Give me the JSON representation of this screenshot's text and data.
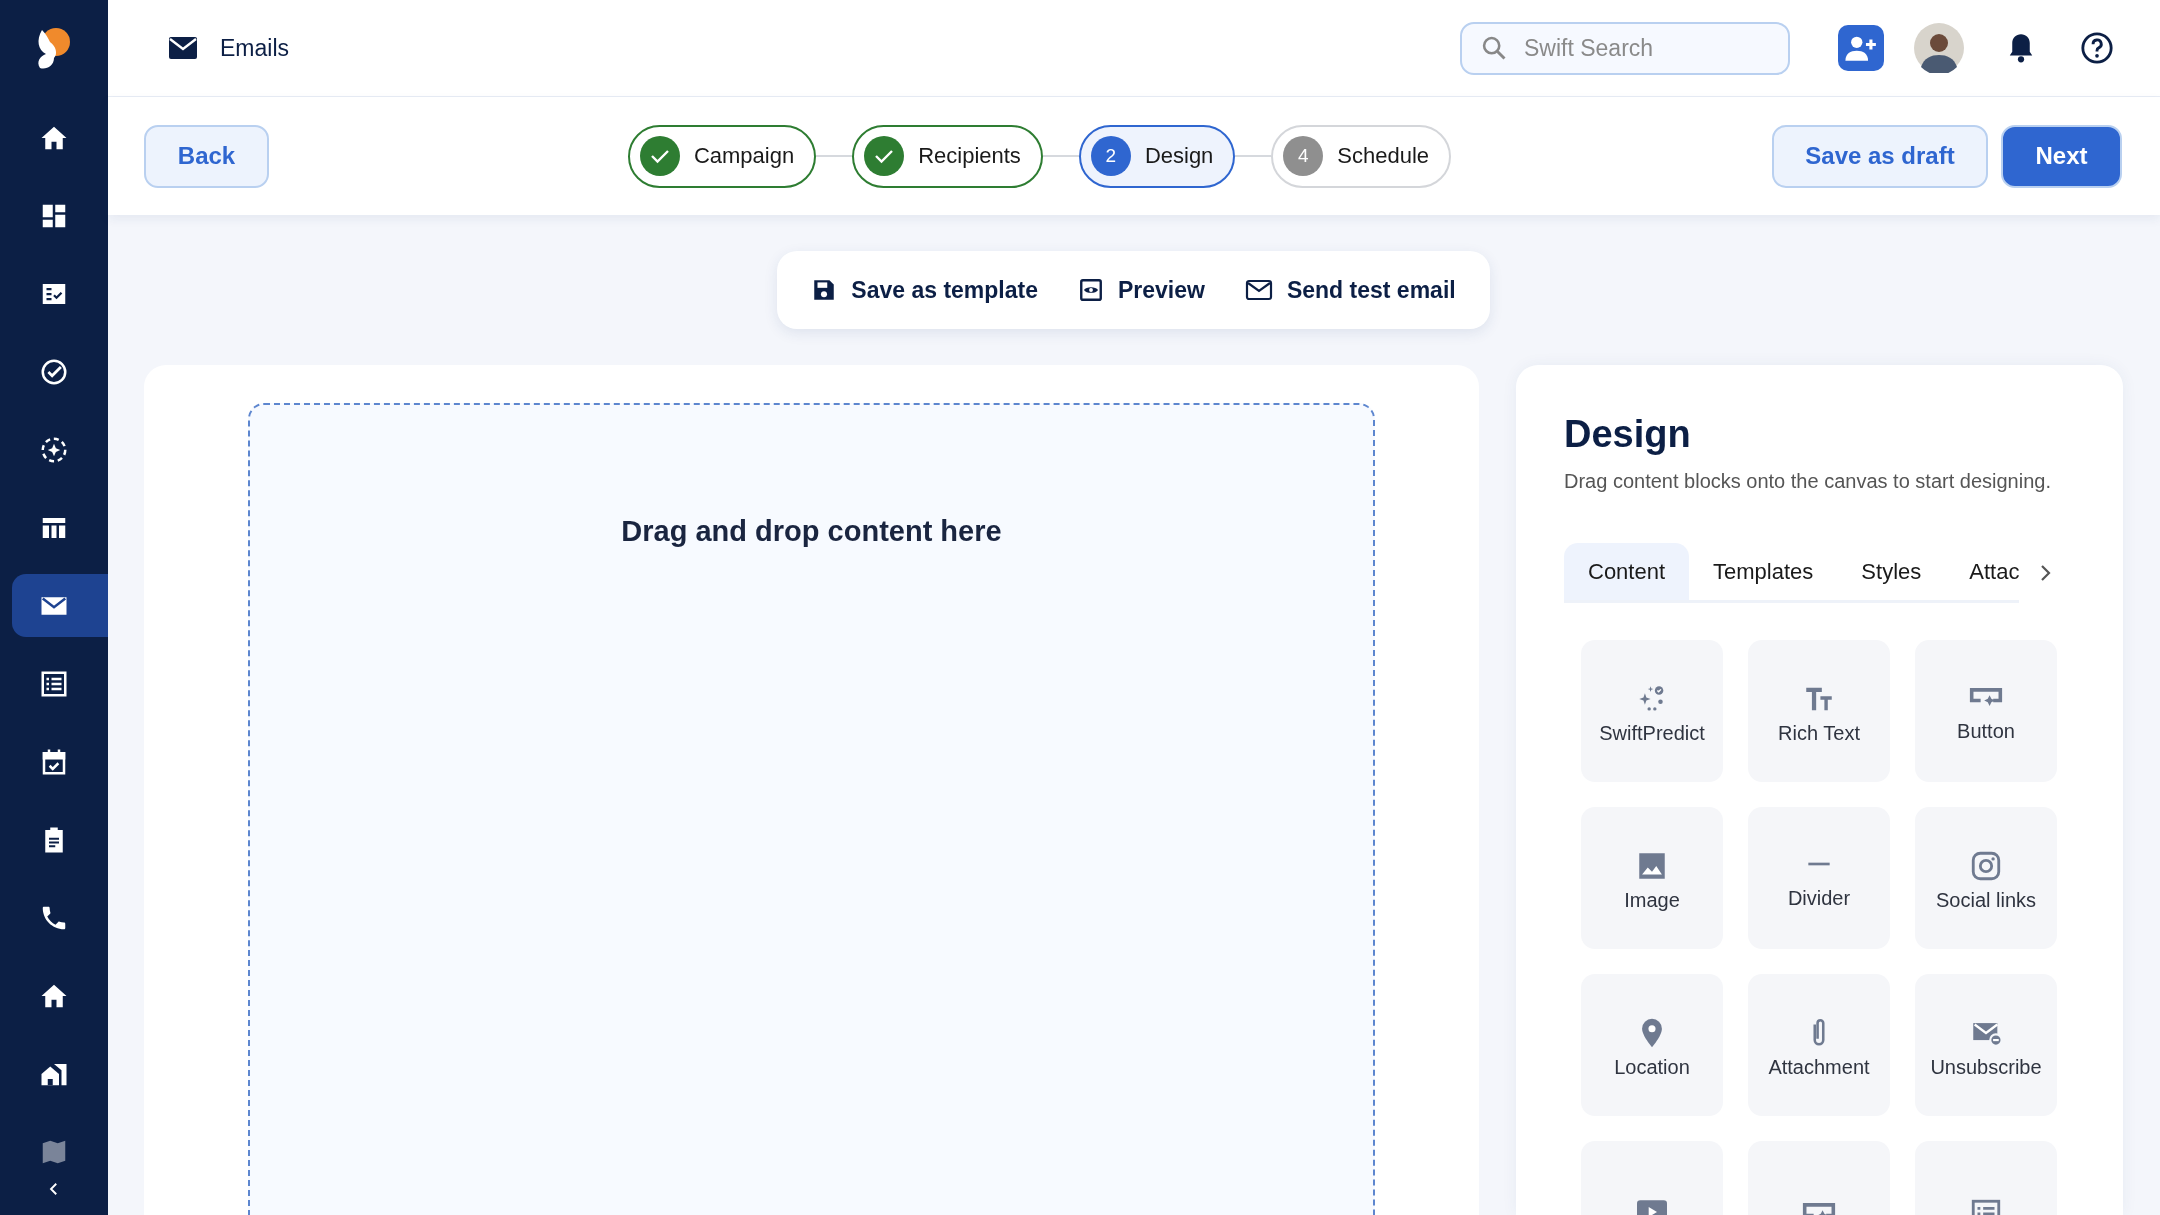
{
  "sidebar": {
    "items": [
      {
        "selected": false
      },
      {
        "selected": false
      },
      {
        "selected": false
      },
      {
        "selected": false
      },
      {
        "selected": false
      },
      {
        "selected": false
      },
      {
        "selected": true
      },
      {
        "selected": false
      },
      {
        "selected": false
      },
      {
        "selected": false
      },
      {
        "selected": false
      },
      {
        "selected": false
      },
      {
        "selected": false
      },
      {
        "selected": false
      }
    ]
  },
  "header": {
    "title": "Emails",
    "search": {
      "placeholder": "Swift Search"
    }
  },
  "wizard": {
    "back": "Back",
    "steps": [
      {
        "label": "Campaign",
        "completed": true,
        "selected": false
      },
      {
        "label": "Recipients",
        "completed": true,
        "selected": false
      },
      {
        "label": "Design",
        "completed": false,
        "selected": true,
        "number": "2"
      },
      {
        "label": "Schedule",
        "completed": false,
        "selected": false,
        "number": "4"
      }
    ],
    "save_draft": "Save as draft",
    "next": "Next"
  },
  "toolbar": [
    "Save as template",
    "Preview",
    "Send test email"
  ],
  "canvas": {
    "drop_hint": "Drag and drop content here"
  },
  "design_panel": {
    "title": "Design",
    "description": "Drag content blocks onto the canvas to start designing.",
    "tabs": [
      {
        "label": "Content",
        "selected": true
      },
      {
        "label": "Templates",
        "selected": false
      },
      {
        "label": "Styles",
        "selected": false
      },
      {
        "label": "Attac",
        "selected": false
      }
    ],
    "blocks": [
      {
        "label": "SwiftPredict"
      },
      {
        "label": "Rich Text"
      },
      {
        "label": "Button"
      },
      {
        "label": "Image"
      },
      {
        "label": "Divider"
      },
      {
        "label": "Social links"
      },
      {
        "label": "Location"
      },
      {
        "label": "Attachment"
      },
      {
        "label": "Unsubscribe"
      }
    ]
  }
}
